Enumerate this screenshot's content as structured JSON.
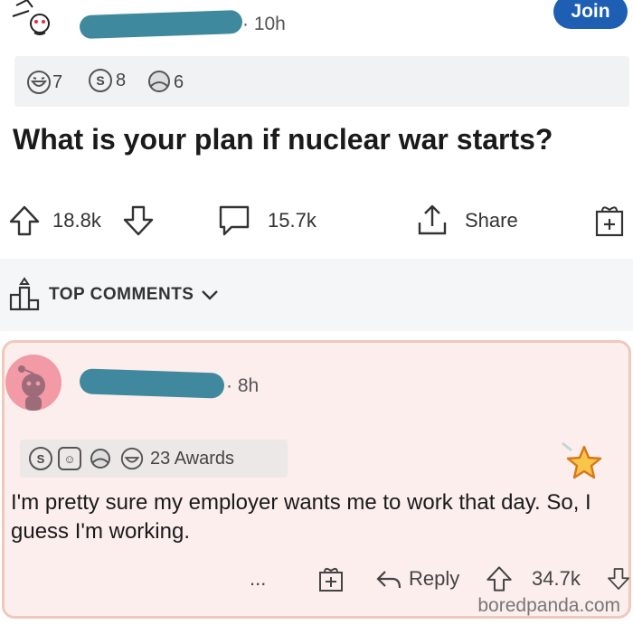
{
  "post": {
    "time": "10h",
    "join_label": "Join",
    "awards": [
      {
        "icon": "laughing-award-icon",
        "count": "7"
      },
      {
        "icon": "silver-award-icon",
        "count": "8"
      },
      {
        "icon": "hug-award-icon",
        "count": "6"
      }
    ],
    "title": "What is your plan if nuclear war starts?",
    "upvotes": "18.8k",
    "comments": "15.7k",
    "share_label": "Share"
  },
  "sort": {
    "label": "TOP COMMENTS"
  },
  "comment": {
    "time": "8h",
    "awards_label": "23 Awards",
    "body": "I'm pretty sure my employer wants me to work that day. So, I guess I'm working.",
    "more_label": "...",
    "reply_label": "Reply",
    "votes": "34.7k"
  },
  "watermark": "boredpanda.com"
}
